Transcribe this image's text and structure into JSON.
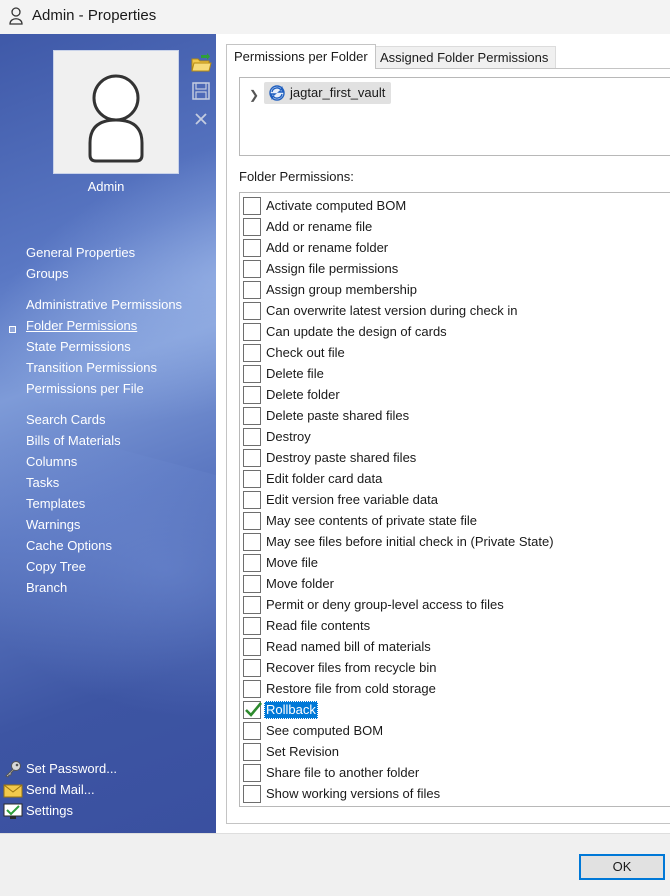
{
  "window": {
    "title": "Admin - Properties"
  },
  "user": {
    "name": "Admin"
  },
  "sidebar": {
    "nav_items": [
      {
        "label": "General Properties"
      },
      {
        "label": "Groups"
      },
      {
        "label": "Administrative Permissions"
      },
      {
        "label": "Folder Permissions",
        "active": true
      },
      {
        "label": "State Permissions"
      },
      {
        "label": "Transition Permissions"
      },
      {
        "label": "Permissions per File"
      },
      {
        "label": "Search Cards"
      },
      {
        "label": "Bills of Materials"
      },
      {
        "label": "Columns"
      },
      {
        "label": "Tasks"
      },
      {
        "label": "Templates"
      },
      {
        "label": "Warnings"
      },
      {
        "label": "Cache Options"
      },
      {
        "label": "Copy Tree"
      },
      {
        "label": "Branch"
      }
    ],
    "bottom_links": [
      {
        "label": "Set Password...",
        "icon": "key-icon"
      },
      {
        "label": "Send Mail...",
        "icon": "mail-icon"
      },
      {
        "label": "Settings",
        "icon": "settings-icon"
      }
    ]
  },
  "tabs": [
    {
      "label": "Permissions per Folder",
      "active": true
    },
    {
      "label": "Assigned Folder Permissions",
      "active": false
    }
  ],
  "tree": {
    "vault_name": "jagtar_first_vault"
  },
  "folder_permissions": {
    "label": "Folder Permissions:",
    "items": [
      {
        "label": "Activate computed BOM",
        "checked": false
      },
      {
        "label": "Add or rename file",
        "checked": false
      },
      {
        "label": "Add or rename folder",
        "checked": false
      },
      {
        "label": "Assign file permissions",
        "checked": false
      },
      {
        "label": "Assign group membership",
        "checked": false
      },
      {
        "label": "Can overwrite latest version during check in",
        "checked": false
      },
      {
        "label": "Can update the design of cards",
        "checked": false
      },
      {
        "label": "Check out file",
        "checked": false
      },
      {
        "label": "Delete file",
        "checked": false
      },
      {
        "label": "Delete folder",
        "checked": false
      },
      {
        "label": "Delete paste shared files",
        "checked": false
      },
      {
        "label": "Destroy",
        "checked": false
      },
      {
        "label": "Destroy paste shared files",
        "checked": false
      },
      {
        "label": "Edit folder card data",
        "checked": false
      },
      {
        "label": "Edit version free variable data",
        "checked": false
      },
      {
        "label": "May see contents of private state file",
        "checked": false
      },
      {
        "label": "May see files before initial check in (Private State)",
        "checked": false
      },
      {
        "label": "Move file",
        "checked": false
      },
      {
        "label": "Move folder",
        "checked": false
      },
      {
        "label": "Permit or deny group-level access to files",
        "checked": false
      },
      {
        "label": "Read file contents",
        "checked": false
      },
      {
        "label": "Read named bill of materials",
        "checked": false
      },
      {
        "label": "Recover files from recycle bin",
        "checked": false
      },
      {
        "label": "Restore file from cold storage",
        "checked": false
      },
      {
        "label": "Rollback",
        "checked": true,
        "selected": true
      },
      {
        "label": "See computed BOM",
        "checked": false
      },
      {
        "label": "Set Revision",
        "checked": false
      },
      {
        "label": "Share file to another folder",
        "checked": false
      },
      {
        "label": "Show working versions of files",
        "checked": false
      }
    ]
  },
  "footer": {
    "ok_label": "OK"
  },
  "colors": {
    "sidebar": "#4a65b3",
    "selection": "#0078d7",
    "check": "#2e8b2e"
  }
}
